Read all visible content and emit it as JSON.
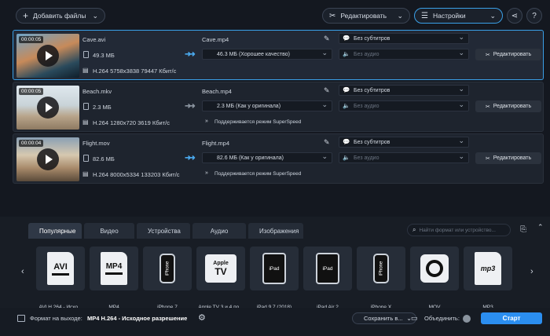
{
  "toolbar": {
    "add_files": "Добавить файлы",
    "edit": "Редактировать",
    "settings": "Настройки"
  },
  "files": [
    {
      "duration": "00:00:05",
      "name": "Cave.avi",
      "size": "49.3 МБ",
      "codec": "H.264 5758x3838 79447 Кбит/с",
      "output_name": "Cave.mp4",
      "output_size": "46.3 МБ (Хорошее качество)",
      "subtitles": "Без субтитров",
      "audio": "Без аудио",
      "edit_label": "Редактировать",
      "superspeed": ""
    },
    {
      "duration": "00:00:05",
      "name": "Beach.mkv",
      "size": "2.3 МБ",
      "codec": "H.264 1280x720 3619 Кбит/с",
      "output_name": "Beach.mp4",
      "output_size": "2.3 МБ (Как у оригинала)",
      "subtitles": "Без субтитров",
      "audio": "Без аудио",
      "edit_label": "Редактировать",
      "superspeed": "Поддерживается режим SuperSpeed"
    },
    {
      "duration": "00:00:04",
      "name": "Flight.mov",
      "size": "82.6 МБ",
      "codec": "H.264 8000x5334 133203 Кбит/с",
      "output_name": "Flight.mp4",
      "output_size": "82.6 МБ (Как у оригинала)",
      "subtitles": "Без субтитров",
      "audio": "Без аудио",
      "edit_label": "Редактировать",
      "superspeed": "Поддерживается режим SuperSpeed"
    }
  ],
  "tabs": [
    "Популярные",
    "Видео",
    "Устройства",
    "Аудио",
    "Изображения"
  ],
  "search_placeholder": "Найти формат или устройство...",
  "formats": [
    {
      "icon": "avi-icon",
      "label": "AVI H.264 - Исхо...",
      "badge": "AVI"
    },
    {
      "icon": "mp4-icon",
      "label": "MP4",
      "badge": "MP4"
    },
    {
      "icon": "iphone-icon",
      "label": "iPhone 7",
      "badge": "iPhone"
    },
    {
      "icon": "apple-tv-icon",
      "label": "Apple TV 3 и 4 по...",
      "badge": "TV"
    },
    {
      "icon": "ipad-icon",
      "label": "iPad 9.7 (2018)",
      "badge": "iPad"
    },
    {
      "icon": "ipad-icon",
      "label": "iPad Air 2",
      "badge": "iPad"
    },
    {
      "icon": "iphone-icon",
      "label": "iPhone X",
      "badge": "iPhone"
    },
    {
      "icon": "mov-icon",
      "label": "MOV",
      "badge": ""
    },
    {
      "icon": "mp3-icon",
      "label": "MP3",
      "badge": "mp3"
    }
  ],
  "footer": {
    "format_label": "Формат на выходе:",
    "format_value": "MP4 H.264 - Исходное разрешение",
    "save_to": "Сохранить в...",
    "merge": "Объединить:",
    "start": "Старт"
  },
  "colors": {
    "accent": "#2b8ef0",
    "selection": "#3aa0e8"
  }
}
